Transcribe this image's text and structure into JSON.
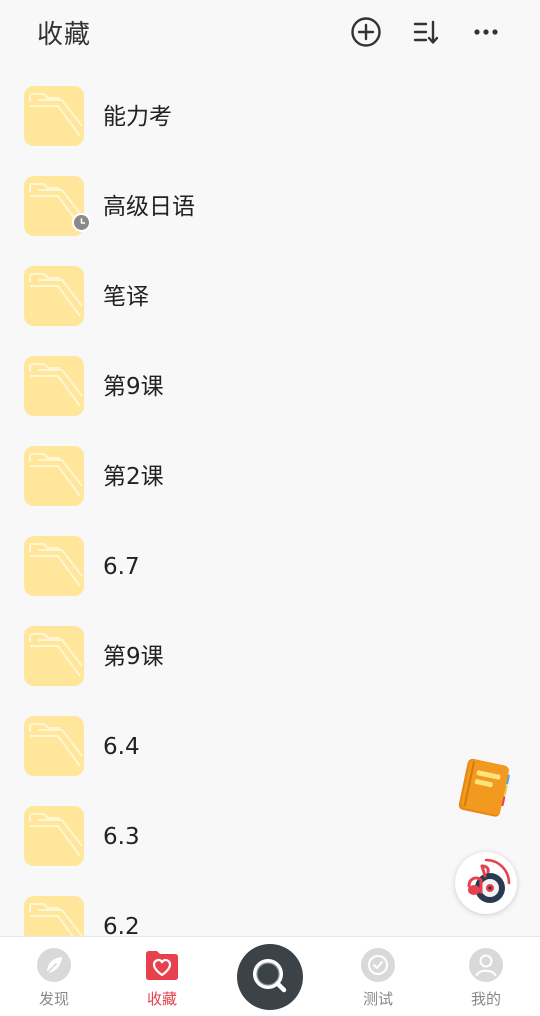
{
  "header": {
    "title": "收藏",
    "add_icon": "plus-circle-icon",
    "sort_icon": "sort-icon",
    "more_icon": "more-dots-icon"
  },
  "folders": [
    {
      "name": "能力考",
      "recent": false
    },
    {
      "name": "高级日语",
      "recent": true
    },
    {
      "name": "笔译",
      "recent": false
    },
    {
      "name": "第9课",
      "recent": false
    },
    {
      "name": "第2课",
      "recent": false
    },
    {
      "name": "6.7",
      "recent": false
    },
    {
      "name": "第9课",
      "recent": false
    },
    {
      "name": "6.4",
      "recent": false
    },
    {
      "name": "6.3",
      "recent": false
    },
    {
      "name": "6.2",
      "recent": false
    }
  ],
  "floating": {
    "notebook_icon": "notebook-icon",
    "music_icon": "music-disc-icon"
  },
  "tabbar": {
    "tabs": [
      {
        "label": "发现",
        "icon": "leaf-icon",
        "active": false
      },
      {
        "label": "收藏",
        "icon": "heart-folder-icon",
        "active": true
      },
      {
        "label": "测试",
        "icon": "check-circle-icon",
        "active": false
      },
      {
        "label": "我的",
        "icon": "user-icon",
        "active": false
      }
    ],
    "center_icon": "search-icon"
  },
  "colors": {
    "accent": "#e8414e",
    "folder": "#ffe69a",
    "background": "#f8f8f8",
    "center_button": "#3b4349"
  }
}
